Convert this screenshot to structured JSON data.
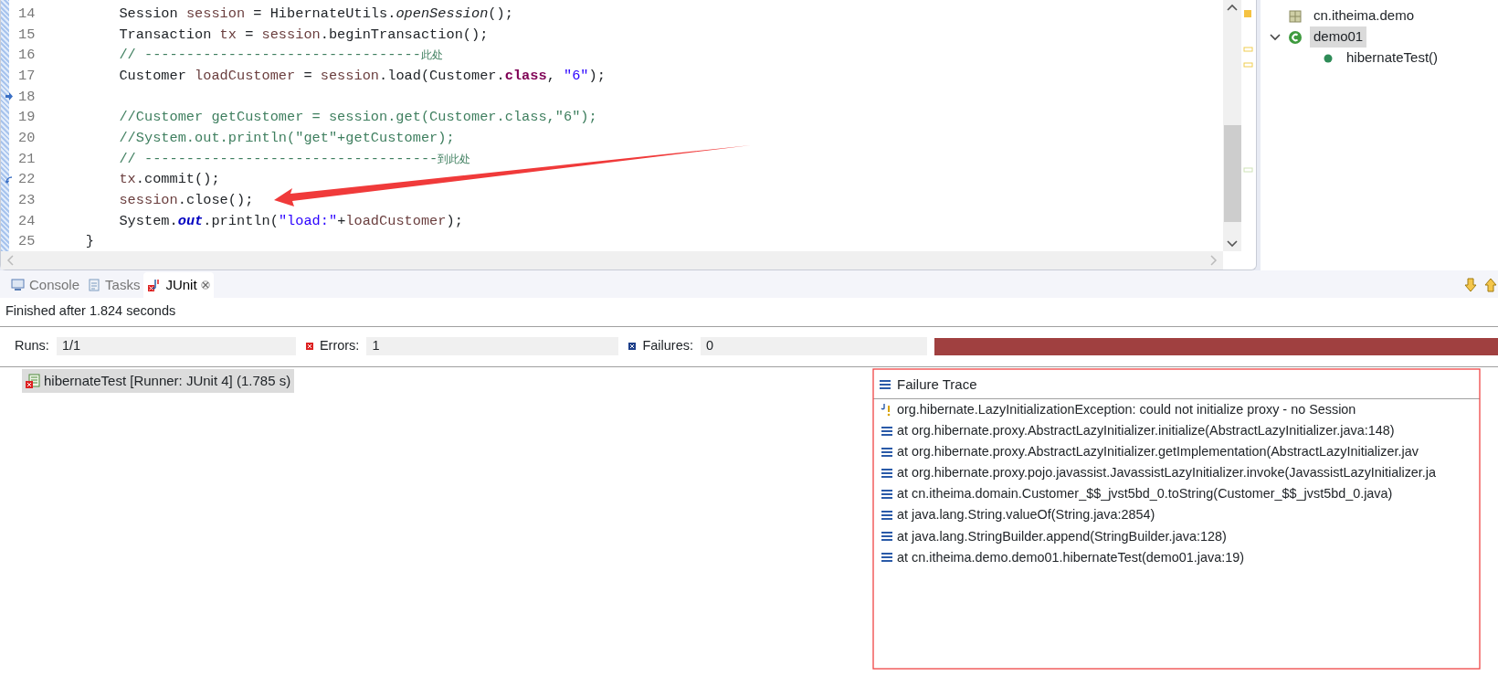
{
  "editor": {
    "lines": [
      {
        "number": "14",
        "tokens": [
          {
            "text": "        Session ",
            "kind": "plain"
          },
          {
            "text": "session",
            "kind": "local"
          },
          {
            "text": " = HibernateUtils.",
            "kind": "plain"
          },
          {
            "text": "openSession",
            "kind": "static-method"
          },
          {
            "text": "();",
            "kind": "plain"
          }
        ]
      },
      {
        "number": "15",
        "tokens": [
          {
            "text": "        Transaction ",
            "kind": "plain"
          },
          {
            "text": "tx",
            "kind": "local"
          },
          {
            "text": " = ",
            "kind": "plain"
          },
          {
            "text": "session",
            "kind": "local"
          },
          {
            "text": ".beginTransaction();",
            "kind": "plain"
          }
        ]
      },
      {
        "number": "16",
        "tokens": [
          {
            "text": "        // ---------------------------------",
            "kind": "comment"
          },
          {
            "text": "此处",
            "kind": "comment-cjk"
          }
        ]
      },
      {
        "number": "17",
        "tokens": [
          {
            "text": "        Customer ",
            "kind": "plain"
          },
          {
            "text": "loadCustomer",
            "kind": "local"
          },
          {
            "text": " = ",
            "kind": "plain"
          },
          {
            "text": "session",
            "kind": "local"
          },
          {
            "text": ".load(Customer.",
            "kind": "plain"
          },
          {
            "text": "class",
            "kind": "keyword"
          },
          {
            "text": ", ",
            "kind": "plain"
          },
          {
            "text": "\"6\"",
            "kind": "string"
          },
          {
            "text": ");",
            "kind": "plain"
          }
        ]
      },
      {
        "number": "18",
        "marker": {
          "kind": "arrow"
        }
      },
      {
        "number": "19",
        "tokens": [
          {
            "text": "        //Customer getCustomer = session.get(Customer.class,\"6\");",
            "kind": "comment"
          }
        ]
      },
      {
        "number": "20",
        "tokens": [
          {
            "text": "        //System.out.println(\"get\"+getCustomer);",
            "kind": "comment"
          }
        ]
      },
      {
        "number": "21",
        "tokens": [
          {
            "text": "        // -----------------------------------",
            "kind": "comment"
          },
          {
            "text": "到此处",
            "kind": "comment-cjk"
          }
        ]
      },
      {
        "number": "22",
        "marker": {
          "kind": "hook"
        },
        "tokens": [
          {
            "text": "        tx",
            "kind": "local"
          },
          {
            "text": ".commit();",
            "kind": "plain"
          }
        ]
      },
      {
        "number": "23",
        "tokens": [
          {
            "text": "        session",
            "kind": "local"
          },
          {
            "text": ".close();",
            "kind": "plain"
          }
        ]
      },
      {
        "number": "24",
        "tokens": [
          {
            "text": "        System.",
            "kind": "plain"
          },
          {
            "text": "out",
            "kind": "static-field"
          },
          {
            "text": ".println(",
            "kind": "plain"
          },
          {
            "text": "\"load:\"",
            "kind": "string"
          },
          {
            "text": "+",
            "kind": "plain"
          },
          {
            "text": "loadCustomer",
            "kind": "local"
          },
          {
            "text": ");",
            "kind": "plain"
          }
        ]
      },
      {
        "number": "25",
        "tokens": [
          {
            "text": "    }",
            "kind": "plain"
          }
        ]
      }
    ]
  },
  "outline": {
    "items": [
      {
        "label": "cn.itheima.demo",
        "kind": "package",
        "selected": false
      },
      {
        "label": "demo01",
        "kind": "class",
        "selected": true,
        "expanded": true,
        "children": [
          {
            "label": "hibernateTest()",
            "kind": "method",
            "selected": false
          }
        ]
      }
    ]
  },
  "bottom_panel": {
    "tabs": [
      {
        "label": "Console",
        "kind": "console",
        "selected": false
      },
      {
        "label": "Tasks",
        "kind": "tasks",
        "selected": false
      },
      {
        "label": "JUnit",
        "kind": "junit",
        "selected": true
      }
    ],
    "status": "Finished after 1.824 seconds",
    "counters": [
      {
        "label": "Runs:",
        "value": "1/1",
        "kind": "runs"
      },
      {
        "label": "Errors:",
        "value": "1",
        "kind": "errors"
      },
      {
        "label": "Failures:",
        "value": "0",
        "kind": "failures"
      }
    ],
    "progress": {
      "level": 1,
      "failed": true
    },
    "tests": [
      {
        "label": "hibernateTest [Runner: JUnit 4] (1.785 s)",
        "selected": true,
        "kind": "error"
      }
    ],
    "failure_trace": {
      "title": "Failure Trace",
      "lines": [
        {
          "text": "org.hibernate.LazyInitializationException: could not initialize proxy - no Session",
          "kind": "exception"
        },
        {
          "text": "at org.hibernate.proxy.AbstractLazyInitializer.initialize(AbstractLazyInitializer.java:148)",
          "kind": "frame"
        },
        {
          "text": "at org.hibernate.proxy.AbstractLazyInitializer.getImplementation(AbstractLazyInitializer.jav",
          "kind": "frame"
        },
        {
          "text": "at org.hibernate.proxy.pojo.javassist.JavassistLazyInitializer.invoke(JavassistLazyInitializer.ja",
          "kind": "frame"
        },
        {
          "text": "at cn.itheima.domain.Customer_$$_jvst5bd_0.toString(Customer_$$_jvst5bd_0.java)",
          "kind": "frame"
        },
        {
          "text": "at java.lang.String.valueOf(String.java:2854)",
          "kind": "frame"
        },
        {
          "text": "at java.lang.StringBuilder.append(StringBuilder.java:128)",
          "kind": "frame"
        },
        {
          "text": "at cn.itheima.demo.demo01.hibernateTest(demo01.java:19)",
          "kind": "frame"
        }
      ]
    }
  }
}
